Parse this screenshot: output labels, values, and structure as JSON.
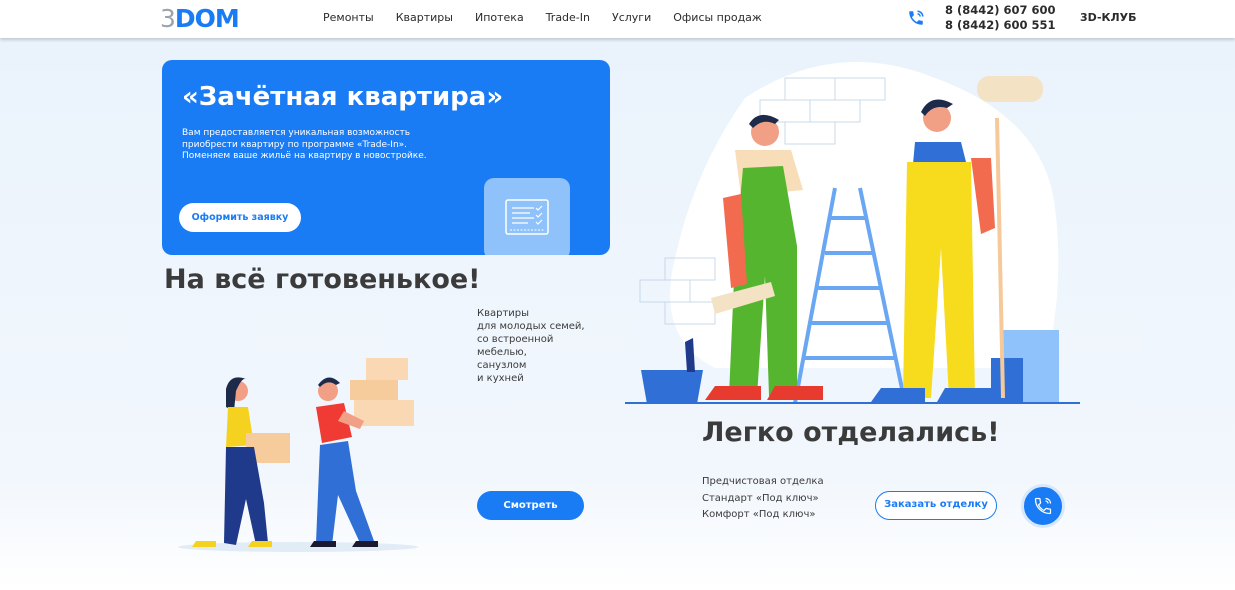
{
  "header": {
    "logo": {
      "prefix": "3",
      "name": "DOM"
    },
    "nav": [
      "Ремонты",
      "Квартиры",
      "Ипотека",
      "Trade-In",
      "Услуги",
      "Офисы продаж"
    ],
    "phones": [
      "8 (8442) 607 600",
      "8 (8442) 600 551"
    ],
    "club": "3D-КЛУБ"
  },
  "promo": {
    "title": "«Зачётная квартира»",
    "text": [
      "Вам предоставляется уникальная возможность",
      "приобрести квартиру по программе «Trade-In».",
      "Поменяем ваше жильё на квартиру в новостройке."
    ],
    "button": "Оформить заявку"
  },
  "ready": {
    "title": "На всё готовенькое!",
    "text": [
      "Квартиры",
      "для молодых семей,",
      "со встроенной",
      "мебелью,",
      "санузлом",
      "и кухней"
    ],
    "button": "Смотреть"
  },
  "finish": {
    "title": "Легко отделались!",
    "items": [
      "Предчистовая отделка",
      "Стандарт «Под ключ»",
      "Комфорт «Под ключ»"
    ],
    "button": "Заказать отделку"
  },
  "colors": {
    "accent": "#1a7cf5",
    "text": "#3b3b3b",
    "background": "#eaf3fc"
  },
  "icons": {
    "phone": "phone-icon",
    "call": "call-icon",
    "document": "document-icon"
  }
}
